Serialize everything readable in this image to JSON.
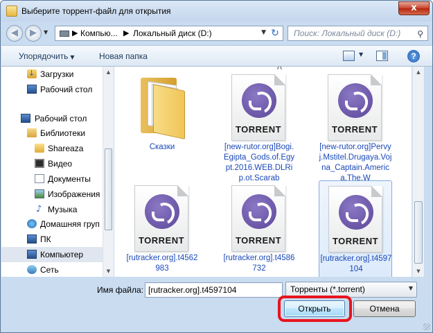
{
  "window": {
    "title": "Выберите торрент-файл для открытия",
    "close_glyph": "x"
  },
  "address": {
    "segments": [
      "Компью...",
      "Локальный диск (D:)"
    ],
    "separator": "▶",
    "search_placeholder": "Поиск: Локальный диск (D:)"
  },
  "toolbar": {
    "organize_label": "Упорядочить",
    "new_folder_label": "Новая папка",
    "help_glyph": "?"
  },
  "sidebar": {
    "items": [
      {
        "label": "Загрузки",
        "icon": "downloads-icon"
      },
      {
        "label": "Рабочий стол",
        "icon": "desktop-icon"
      },
      {
        "label": "Рабочий стол",
        "icon": "desktop-icon"
      },
      {
        "label": "Библиотеки",
        "icon": "library-icon"
      },
      {
        "label": "Shareaza",
        "icon": "folder-icon"
      },
      {
        "label": "Видео",
        "icon": "video-icon"
      },
      {
        "label": "Документы",
        "icon": "documents-icon"
      },
      {
        "label": "Изображения",
        "icon": "images-icon"
      },
      {
        "label": "Музыка",
        "icon": "music-icon"
      },
      {
        "label": "Домашняя груп",
        "icon": "homegroup-icon"
      },
      {
        "label": "ПК",
        "icon": "computer-icon"
      },
      {
        "label": "Компьютер",
        "icon": "computer-icon",
        "selected": true
      },
      {
        "label": "Сеть",
        "icon": "network-icon"
      }
    ]
  },
  "files": [
    {
      "name": "Сказки",
      "type": "folder"
    },
    {
      "name": "[new-rutor.org]Bogi.Egipta_Gods.of.Egypt.2016.WEB.DLRip.ot.Scarab",
      "type": "torrent",
      "badge": "TORRENT"
    },
    {
      "name": "[new-rutor.org]Pervyj.Mstitel.Drugaya.Vojna_Captain.America.The.W",
      "type": "torrent",
      "badge": "TORRENT"
    },
    {
      "name": "[rutracker.org].t4562983",
      "type": "torrent",
      "badge": "TORRENT"
    },
    {
      "name": "[rutracker.org].t4586732",
      "type": "torrent",
      "badge": "TORRENT"
    },
    {
      "name": "[rutracker.org].t4597104",
      "type": "torrent",
      "badge": "TORRENT",
      "selected": true
    }
  ],
  "bottom": {
    "filename_label": "Имя файла:",
    "filename_value": "[rutracker.org].t4597104",
    "filetype_value": "Торренты (*.torrent)",
    "open_label": "Открыть",
    "cancel_label": "Отмена"
  },
  "colors": {
    "accent": "#e8141d",
    "link": "#1a48b8",
    "torrent_logo": "#6a54aa"
  }
}
